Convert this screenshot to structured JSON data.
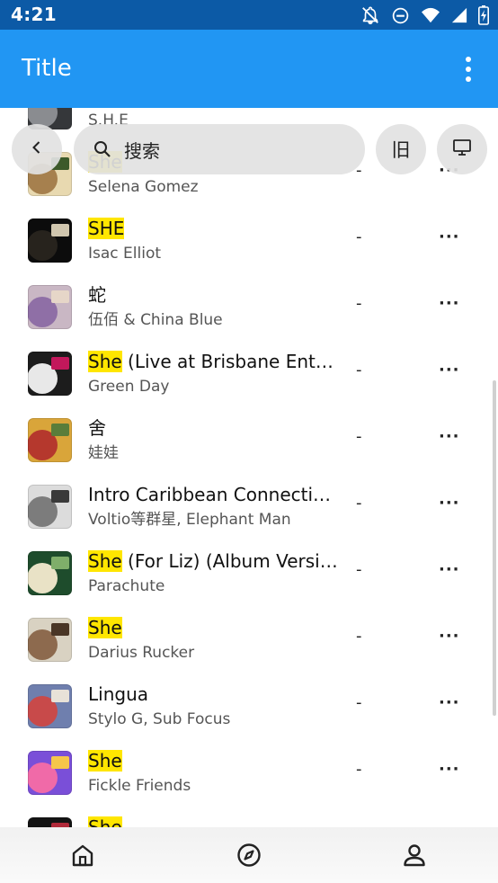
{
  "status_bar": {
    "time": "4:21",
    "icons": [
      "notifications-off-icon",
      "do-not-disturb-icon",
      "wifi-icon",
      "cellular-signal-icon",
      "battery-charging-icon"
    ]
  },
  "app_bar": {
    "title": "Title",
    "menu_icon": "more-vert-icon"
  },
  "search_bar": {
    "back_icon": "chevron-left-icon",
    "search_icon": "search-icon",
    "query": "搜索",
    "old_button_label": "旧",
    "screen_icon": "monitor-icon"
  },
  "songs": [
    {
      "highlight": "",
      "title": "",
      "artist": "S.H.E",
      "duration": "",
      "more": "",
      "colors": [
        "#35373a",
        "#8a8c90",
        "#d0d2d6"
      ]
    },
    {
      "highlight": "She",
      "title": "",
      "artist": "Selena Gomez",
      "duration": "-",
      "more": "···",
      "colors": [
        "#e8d9b0",
        "#a6804e",
        "#3c5a2a"
      ]
    },
    {
      "highlight": "SHE",
      "title": "",
      "artist": "Isac Elliot",
      "duration": "-",
      "more": "···",
      "colors": [
        "#0c0c0c",
        "#27231d",
        "#d0c6ae"
      ]
    },
    {
      "highlight": "",
      "title": "蛇",
      "artist": "伍佰 & China Blue",
      "duration": "-",
      "more": "···",
      "colors": [
        "#c9b7c4",
        "#8f6fa6",
        "#e6d6c8"
      ]
    },
    {
      "highlight": "She",
      "title": " (Live at Brisbane Ent…",
      "artist": "Green Day",
      "duration": "-",
      "more": "···",
      "colors": [
        "#1c1c1c",
        "#e8e8e8",
        "#c2185b"
      ]
    },
    {
      "highlight": "",
      "title": "舍",
      "artist": "娃娃",
      "duration": "-",
      "more": "···",
      "colors": [
        "#d9a53a",
        "#b5382d",
        "#5a7d3a"
      ]
    },
    {
      "highlight": "",
      "title": "Intro Caribbean Connecti…",
      "artist": "Voltio等群星, Elephant Man",
      "duration": "-",
      "more": "···",
      "colors": [
        "#dcdcdc",
        "#7c7c7c",
        "#3a3a3a"
      ]
    },
    {
      "highlight": "She",
      "title": " (For Liz) (Album Versi…",
      "artist": "Parachute",
      "duration": "-",
      "more": "···",
      "colors": [
        "#1e4c2c",
        "#e9e2c6",
        "#7fae6a"
      ]
    },
    {
      "highlight": "She",
      "title": "",
      "artist": "Darius Rucker",
      "duration": "-",
      "more": "···",
      "colors": [
        "#d9d2c2",
        "#8d6a4e",
        "#4a3626"
      ]
    },
    {
      "highlight": "",
      "title": "Lingua",
      "artist": "Stylo G, Sub Focus",
      "duration": "-",
      "more": "···",
      "colors": [
        "#6f7fae",
        "#c84a4a",
        "#e8e2d8"
      ]
    },
    {
      "highlight": "She",
      "title": "",
      "artist": "Fickle Friends",
      "duration": "-",
      "more": "···",
      "colors": [
        "#7a4fd8",
        "#f06aa8",
        "#f6c64a"
      ]
    },
    {
      "highlight": "She",
      "title": "",
      "artist": "",
      "duration": "-",
      "more": "···",
      "colors": [
        "#141414",
        "#d8c0a0",
        "#b02a3a"
      ]
    }
  ],
  "bottom_nav": {
    "items": [
      "home-icon",
      "explore-icon",
      "profile-icon"
    ]
  }
}
